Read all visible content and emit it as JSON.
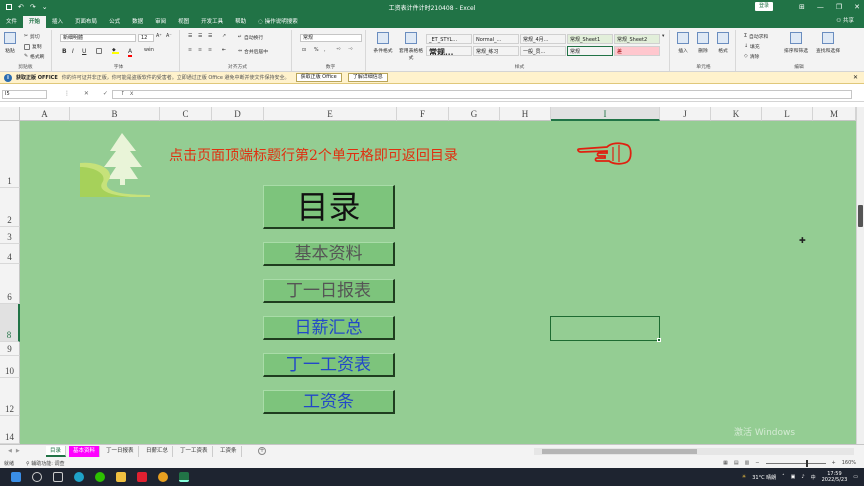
{
  "titlebar": {
    "title": "工资表计件计时210408  -  Excel",
    "login": "登录",
    "undo": "↶",
    "redo": "↷",
    "qat_more": "⌄",
    "minimize": "—",
    "restore": "❐",
    "close": "✕",
    "ribbon_display": "⊞"
  },
  "tabs": {
    "file": "文件",
    "home": "开始",
    "insert": "插入",
    "layout": "页面布局",
    "formulas": "公式",
    "data": "数据",
    "review": "审阅",
    "view": "视图",
    "developer": "开发工具",
    "help": "帮助",
    "tellme": "操作说明搜索",
    "share": "共享"
  },
  "ribbon": {
    "clipboard": {
      "label": "剪贴板",
      "paste": "粘贴",
      "cut": "剪切",
      "copy": "复制",
      "painter": "格式刷"
    },
    "font": {
      "label": "字体",
      "name": "新细明體",
      "size": "12",
      "bold": "B",
      "italic": "I",
      "underline": "U",
      "grow": "A⁺",
      "shrink": "A⁻",
      "wen": "wén"
    },
    "alignment": {
      "label": "对齐方式",
      "wrap": "自动换行",
      "merge": "合并后居中"
    },
    "number": {
      "label": "数字",
      "format": "常规",
      "percent": "%",
      "comma": ","
    },
    "styles": {
      "label": "样式",
      "conditional": "条件格式",
      "table": "套用表格格式",
      "cells": [
        {
          "text": "_ET_STYL...",
          "bg": "#ffffff",
          "color": "#000000"
        },
        {
          "text": "Normal_...",
          "bg": "#ffffff",
          "color": "#000000"
        },
        {
          "text": "常规_4月...",
          "bg": "#ffffff",
          "color": "#000000"
        },
        {
          "text": "常规_Sheet1",
          "bg": "#ffffff",
          "color": "#000000"
        },
        {
          "text": "常规_Sheet2",
          "bg": "#ffffff",
          "color": "#000000"
        },
        {
          "text": "常规...",
          "bg": "#ffffff",
          "color": "#000000"
        },
        {
          "text": "常规_练习",
          "bg": "#ffffff",
          "color": "#000000"
        },
        {
          "text": "一般_员...",
          "bg": "#ffffff",
          "color": "#000000"
        },
        {
          "text": "常规",
          "bg": "#ffffff",
          "color": "#000000"
        },
        {
          "text": "差",
          "bg": "#ffc7ce",
          "color": "#9c0006"
        }
      ]
    },
    "cells_group": {
      "label": "单元格",
      "insert": "插入",
      "delete": "删除",
      "format": "格式"
    },
    "editing": {
      "label": "编辑",
      "autosum": "自动求和",
      "fill": "填充",
      "clear": "清除",
      "sort": "排序和筛选",
      "find": "查找和选择"
    }
  },
  "message_bar": {
    "title": "获取正版 OFFICE",
    "text": "你的许可证并非正版，你可能是盗版软件的受害者。立即通过正版 Office 避免中断并使文件保持安全。",
    "button1": "获取正版 Office",
    "button2": "了解详细信息",
    "close": "✕"
  },
  "formula_bar": {
    "name_box": "I5",
    "buttons": "⋮ ✕ ✓ fx",
    "value": ""
  },
  "columns": [
    "A",
    "B",
    "C",
    "D",
    "E",
    "F",
    "G",
    "H",
    "I",
    "J",
    "K",
    "L",
    "M"
  ],
  "rows": [
    "1",
    "2",
    "3",
    "4",
    "6",
    "8",
    "9",
    "10",
    "12",
    "14"
  ],
  "sheet": {
    "title": "点击页面顶端标题行第2个单元格即可返回目录",
    "menu": [
      "目录",
      "基本资料",
      "丁一日报表",
      "日薪汇总",
      "丁一工资表",
      "工资条"
    ],
    "watermark": "激活 Windows"
  },
  "sheet_tabs": [
    "目录",
    "基本资料",
    "丁一日报表",
    "日薪汇总",
    "丁一工资表",
    "工资条"
  ],
  "status": {
    "ready": "就绪",
    "accessibility": "辅助功能: 调查",
    "zoom": "160%"
  },
  "taskbar": {
    "weather": "31°C 晴朗",
    "time": "17:59",
    "date": "2022/5/23"
  },
  "colors": {
    "excel_green": "#217346",
    "sheet_bg": "#94cd93",
    "button_bg": "#7dc47c",
    "title_red": "#e03010",
    "link_blue": "#2248c8"
  }
}
